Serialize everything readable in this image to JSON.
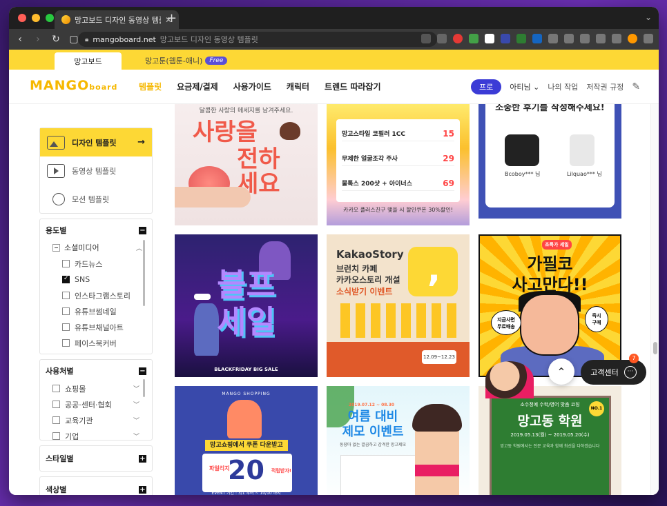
{
  "browser": {
    "tab_title": "망고보드 디자인 동영상 템플릿",
    "new_tab_label": "+",
    "url_host": "mangoboard.net",
    "url_title": "망고보드 디자인 동영상 템플릿"
  },
  "site_tabs": {
    "primary": "망고보드",
    "secondary": "망고툰(웹툰-애니)",
    "free_badge": "Free"
  },
  "header": {
    "logo_main": "MANGO",
    "logo_sub": "board",
    "menu": [
      {
        "label": "템플릿",
        "active": true
      },
      {
        "label": "요금제/결제",
        "active": false
      },
      {
        "label": "사용가이드",
        "active": false
      },
      {
        "label": "캐릭터",
        "active": false
      },
      {
        "label": "트렌드 따라잡기",
        "active": false
      }
    ],
    "pro_label": "프로",
    "user_label": "아티님 ⌄",
    "my_work": "나의 작업",
    "copyright": "저작권 규정"
  },
  "sidebar": {
    "templates": [
      {
        "label": "디자인 템플릿",
        "active": true
      },
      {
        "label": "동영상 템플릿",
        "active": false
      },
      {
        "label": "모션 템플릿",
        "active": false
      }
    ],
    "usage": {
      "title": "용도별",
      "group": "소셜미디어",
      "items": [
        {
          "label": "카드뉴스",
          "checked": false
        },
        {
          "label": "SNS",
          "checked": true
        },
        {
          "label": "인스타그램스토리",
          "checked": false
        },
        {
          "label": "유튜브썸네일",
          "checked": false
        },
        {
          "label": "유튜브채널아트",
          "checked": false
        },
        {
          "label": "페이스북커버",
          "checked": false
        }
      ]
    },
    "user_type": {
      "title": "사용처별",
      "items": [
        {
          "label": "쇼핑몰"
        },
        {
          "label": "공공·센터·협회"
        },
        {
          "label": "교육기관"
        },
        {
          "label": "기업"
        }
      ]
    },
    "style_title": "스타일별",
    "color_title": "색상별"
  },
  "cards": {
    "c1": {
      "sub": "달콤한 사랑의 메세지를 남겨주세요.",
      "line1": "사랑을",
      "line2": "전하\n세요"
    },
    "c2": {
      "title": "망고스타일 코필러 1CC",
      "rows": [
        {
          "name": "망고스타일 코필러 1CC",
          "price": "15"
        },
        {
          "name": "무제한 얼굴조각 주사",
          "price": "29"
        },
        {
          "name": "물톡스 200샷 + 아이너스",
          "price": "69"
        }
      ],
      "footer": "카카오 플러스친구 맺을 시 할인쿠폰 30%할인!"
    },
    "c3": {
      "title": "소중한 후기를 작성해주세요!",
      "left": "Bcoboy*** 님",
      "right": "Lilquao*** 님"
    },
    "c4": {
      "title": "블프\n세일",
      "footer": "BLACKFRIDAY BIG SALE"
    },
    "c5": {
      "line1": "KakaoStory",
      "line2": "브런치 카페\n카카오스토리 개설",
      "line3": "소식받기 이벤트",
      "date": "12.09~12.23"
    },
    "c6": {
      "tag": "초특가 세일",
      "line1": "가필코\n사고만다!!",
      "bubble1": "지금사면\n무료배송",
      "bubble2": "즉시\n구매"
    },
    "c7": {
      "brand": "MANGO SHOPPING",
      "header": "망고쇼핑에서 쿠폰 다운받고",
      "number": "20",
      "left": "파일리지",
      "right": "적립받자!",
      "footer": "EVENT 기간 : 3/1 부터 ~ 10/10 까지"
    },
    "c8": {
      "top": "2019.07.12 ~ 08.30",
      "title": "여름 대비\n제모 이벤트",
      "sub": "동장마 없는 깔끔하고 감격한 망고제모"
    },
    "c9": {
      "small": "소수정예 수학/영어 맞춤 코칭",
      "title": "망고동 학원",
      "dates": "2019.05.13(월) ~ 2019.05.20(수)",
      "desc": "망고동 학원에서는 전문 교육과 함께 최선을 다하겠습니다",
      "badge": "NO.1"
    }
  },
  "floating": {
    "top_arrow": "⌃",
    "cs_label": "고객센터",
    "cs_badge": "7"
  },
  "colors": {
    "brand_yellow": "#fdd835",
    "pro_blue": "#3b3bd6",
    "logo_orange": "#f6b800"
  }
}
